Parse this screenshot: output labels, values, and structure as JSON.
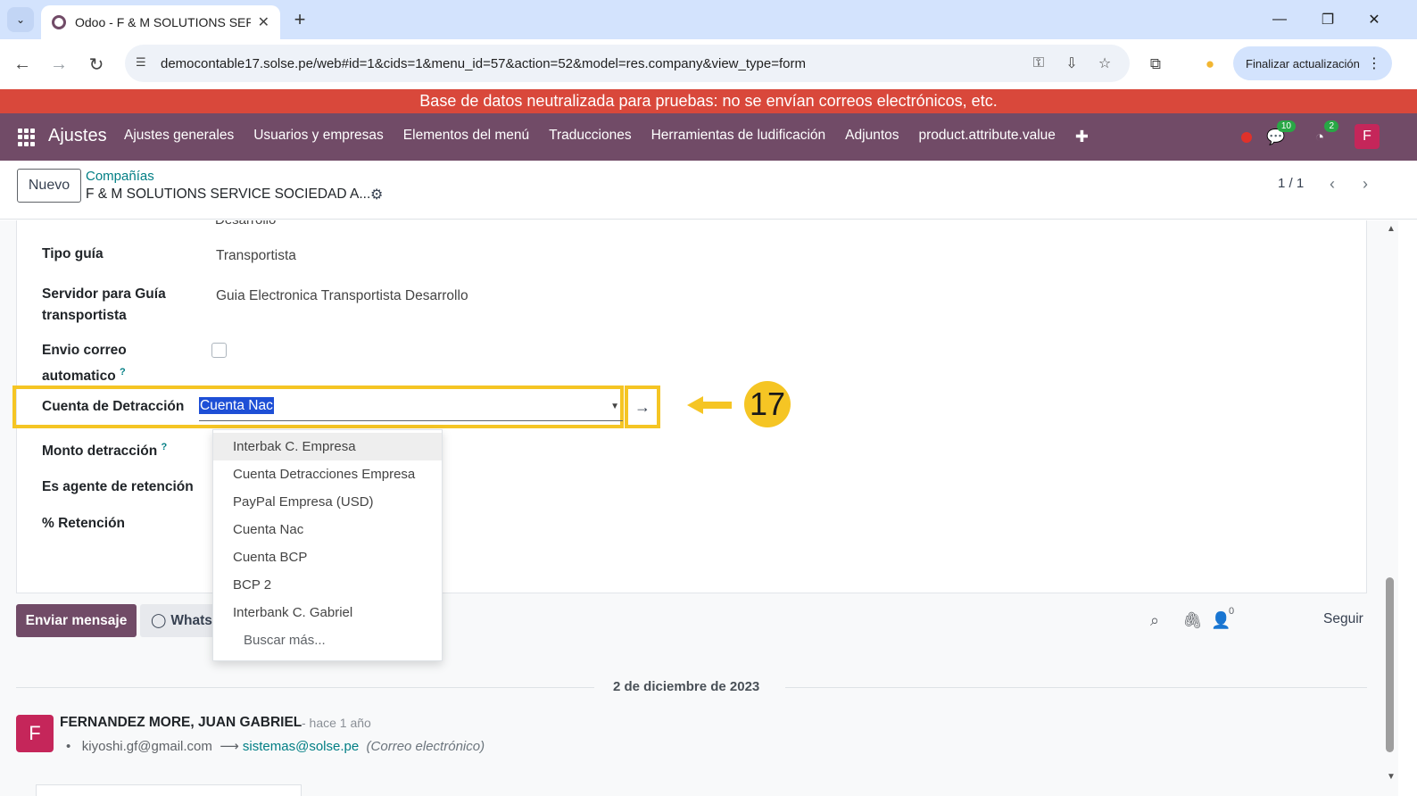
{
  "browser": {
    "tab_title": "Odoo - F & M SOLUTIONS SER",
    "url": "democontable17.solse.pe/web#id=1&cids=1&menu_id=57&action=52&model=res.company&view_type=form",
    "update_button": "Finalizar actualización",
    "icons": [
      "tab-list-icon",
      "new-tab-icon",
      "minimize-icon",
      "restore-icon",
      "close-window-icon",
      "back-icon",
      "forward-icon",
      "reload-icon",
      "site-info-icon",
      "password-key-icon",
      "install-icon",
      "bookmark-star-icon",
      "extensions-icon",
      "profile-icon",
      "menu-dots-icon"
    ]
  },
  "banner": {
    "text": "Base de datos neutralizada para pruebas: no se envían correos electrónicos, etc."
  },
  "navbar": {
    "brand": "Ajustes",
    "menu": [
      "Ajustes generales",
      "Usuarios y empresas",
      "Elementos del menú",
      "Traducciones",
      "Herramientas de ludificación",
      "Adjuntos",
      "product.attribute.value"
    ],
    "plus": "✚",
    "messages_badge": "10",
    "activities_badge": "2",
    "avatar_letter": "F",
    "colors": {
      "navbar": "#714b67",
      "banner": "#d9483b",
      "avatar": "#c5265a"
    }
  },
  "control_panel": {
    "new_button": "Nuevo",
    "breadcrumb_parent": "Compañías",
    "breadcrumb_current": "F & M SOLUTIONS SERVICE SOCIEDAD A...",
    "pager": "1 / 1"
  },
  "form": {
    "cutoff_value": "Desarrollo",
    "fields": {
      "tipo_guia": {
        "label": "Tipo guía",
        "value": "Transportista"
      },
      "servidor_guia": {
        "label_line1": "Servidor para Guía",
        "label_line2": "transportista",
        "value": "Guia Electronica Transportista Desarrollo"
      },
      "envio_correo": {
        "label_line1": "Envio correo",
        "label_line2": "automatico",
        "help": "?",
        "checked": false
      },
      "cuenta_detraccion": {
        "label": "Cuenta de Detracción",
        "input_value": "Cuenta Nac"
      },
      "monto_detraccion": {
        "label": "Monto detracción",
        "help": "?"
      },
      "agente_retencion": {
        "label": "Es agente de retención"
      },
      "retencion": {
        "label": "% Retención"
      }
    },
    "dropdown_options": [
      "Interbak C. Empresa",
      "Cuenta Detracciones Empresa",
      "PayPal Empresa (USD)",
      "Cuenta Nac",
      "Cuenta BCP",
      "BCP 2",
      "Interbank C. Gabriel"
    ],
    "dropdown_more": "Buscar más...",
    "callout_number": "17",
    "highlight_color": "#f5c524"
  },
  "chatter": {
    "send_button": "Enviar mensaje",
    "whatsapp_button": "WhatsApp",
    "followers_count": "0",
    "follow_button": "Seguir",
    "date_separator": "2 de diciembre de 2023",
    "message": {
      "avatar_letter": "F",
      "author": "FERNANDEZ MORE, JUAN GABRIEL",
      "date": "- hace 1 año",
      "from": "kiyoshi.gf@gmail.com",
      "to": "sistemas@solse.pe",
      "kind": "(Correo electrónico)"
    }
  }
}
